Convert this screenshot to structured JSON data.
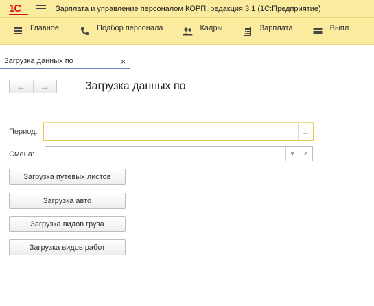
{
  "window": {
    "logo_text": "1С",
    "title": "Зарплата и управление персоналом КОРП, редакция 3.1  (1С:Предприятие)"
  },
  "sections": [
    {
      "label": "Главное",
      "icon": "hamburger-list-icon"
    },
    {
      "label": "Подбор персонала",
      "icon": "phone-icon"
    },
    {
      "label": "Кадры",
      "icon": "people-icon"
    },
    {
      "label": "Зарплата",
      "icon": "calculator-icon"
    },
    {
      "label": "Выпл",
      "icon": "wallet-icon"
    }
  ],
  "tab": {
    "label": "Загрузка данных по",
    "close": "×"
  },
  "form": {
    "back": "←",
    "forward": "→",
    "title": "Загрузка данных по",
    "period_label": "Период:",
    "period_value": "",
    "period_select": "...",
    "shift_label": "Смена:",
    "shift_value": "",
    "shift_dropdown": "▾",
    "shift_clear": "×",
    "buttons": [
      "Загрузка путевых листов",
      "Загрузка авто",
      "Загрузка видов груза",
      "Загрузка видов работ"
    ]
  }
}
